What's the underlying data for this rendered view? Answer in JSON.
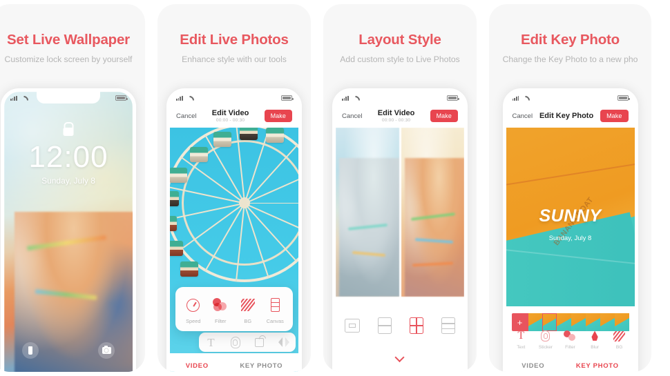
{
  "panels": [
    {
      "title": "Set Live Wallpaper",
      "subtitle": "Customize lock screen by yourself",
      "screen": "lockscreen",
      "lockscreen": {
        "time": "12:00",
        "date": "Sunday, July 8",
        "lock_icon": "lock-icon",
        "flashlight_icon": "flashlight-icon",
        "camera_icon": "camera-icon"
      }
    },
    {
      "title": "Edit Live Photos",
      "subtitle": "Enhance style with our tools",
      "screen": "edit-video",
      "header": {
        "cancel": "Cancel",
        "title": "Edit Video",
        "time_range": "00:00 - 00:30",
        "make": "Make"
      },
      "tool_popup": [
        {
          "label": "Speed",
          "icon": "speed-icon"
        },
        {
          "label": "Filter",
          "icon": "filter-icon"
        },
        {
          "label": "BG",
          "icon": "background-icon"
        },
        {
          "label": "Canvas",
          "icon": "canvas-icon"
        }
      ],
      "icon_bar": [
        {
          "icon": "text-icon"
        },
        {
          "icon": "sticker-fingerprint-icon"
        },
        {
          "icon": "rotate-icon"
        },
        {
          "icon": "flip-icon"
        }
      ],
      "tabs": [
        {
          "label": "VIDEO",
          "active": true
        },
        {
          "label": "KEY PHOTO",
          "active": false
        }
      ]
    },
    {
      "title": "Layout Style",
      "subtitle": "Add custom style to Live Photos",
      "screen": "layout-style",
      "header": {
        "cancel": "Cancel",
        "title": "Edit Video",
        "time_range": "00:00 - 00:30",
        "make": "Make"
      },
      "layout_options": [
        {
          "icon": "layout-1-1-icon",
          "selected": false
        },
        {
          "icon": "layout-two-rows-icon",
          "selected": false
        },
        {
          "icon": "layout-quad-icon",
          "selected": true
        },
        {
          "icon": "layout-three-rows-icon",
          "selected": false
        }
      ],
      "expand_icon": "chevron-down-icon"
    },
    {
      "title": "Edit Key Photo",
      "subtitle": "Change the Key Photo to a new pho",
      "screen": "edit-key-photo",
      "header": {
        "cancel": "Cancel",
        "title": "Edit Key Photo",
        "make": "Make"
      },
      "photo": {
        "headline": "SUNNY",
        "date": "Sunday, July 8",
        "watermark": "BANANA BOAT"
      },
      "filmstrip": {
        "add_label": "+",
        "frames": 7,
        "selected_index": 1
      },
      "tools": [
        {
          "label": "Text",
          "icon": "text-icon"
        },
        {
          "label": "Sticker",
          "icon": "sticker-fingerprint-icon"
        },
        {
          "label": "Filter",
          "icon": "filter-icon"
        },
        {
          "label": "Blur",
          "icon": "blur-drop-icon"
        },
        {
          "label": "BG",
          "icon": "background-icon"
        }
      ],
      "tabs": [
        {
          "label": "VIDEO",
          "active": false
        },
        {
          "label": "KEY PHOTO",
          "active": true
        }
      ]
    }
  ],
  "colors": {
    "accent": "#e8454f",
    "title": "#e8585f",
    "subtitle": "#b5b5b5",
    "card_bg": "#f7f7f7",
    "tab_inactive": "#8d8d8d"
  }
}
